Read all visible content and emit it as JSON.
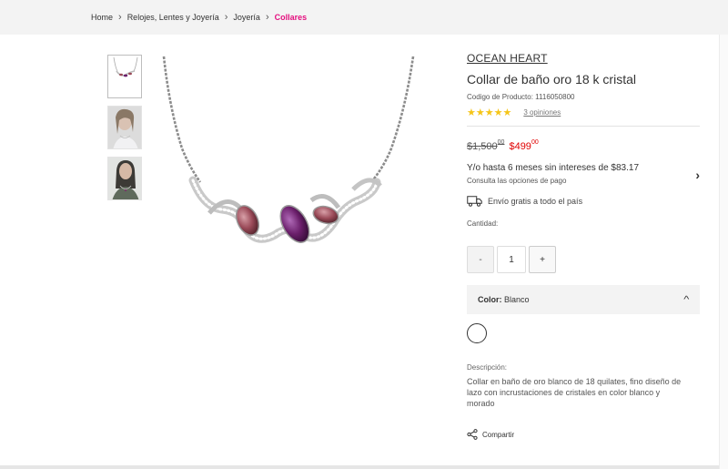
{
  "breadcrumb": {
    "items": [
      "Home",
      "Relojes, Lentes y Joyería",
      "Joyería"
    ],
    "current": "Collares"
  },
  "product": {
    "brand": "OCEAN HEART",
    "title": "Collar de baño oro 18 k cristal",
    "sku": "Codigo de Producto: 1116050800",
    "rating": 5,
    "rating_stars": "★★★★★",
    "reviews": "3 opiniones",
    "old_price": "$1,500",
    "old_price_cents": "00",
    "new_price": "$499",
    "new_price_cents": "00",
    "installments_text": "Y/o hasta 6 meses sin intereses de $83.17",
    "installments_sub": "Consulta las opciones de pago",
    "shipping": "Envío gratis a todo el país",
    "quantity_label": "Cantidad:",
    "quantity": "1",
    "minus_label": "-",
    "plus_label": "+",
    "color_label": "Color:",
    "color_value": "Blanco",
    "description_label": "Descripción:",
    "description": "Collar en baño de oro blanco de 18 quilates, fino diseño de lazo con incrustaciones de cristales en color blanco y morado",
    "share_label": "Compartir"
  },
  "colors": {
    "accent": "#e4107f",
    "sale_price": "#e00000",
    "stars": "#f5c518",
    "amethyst": "#6b1f6b",
    "rose_crystal": "#9a4a58"
  },
  "icons": {
    "breadcrumb_separator": "chevron-right-icon",
    "installments": "chevron-right-icon",
    "shipping": "truck-icon",
    "color_panel": "chevron-up-icon",
    "share": "share-icon"
  }
}
